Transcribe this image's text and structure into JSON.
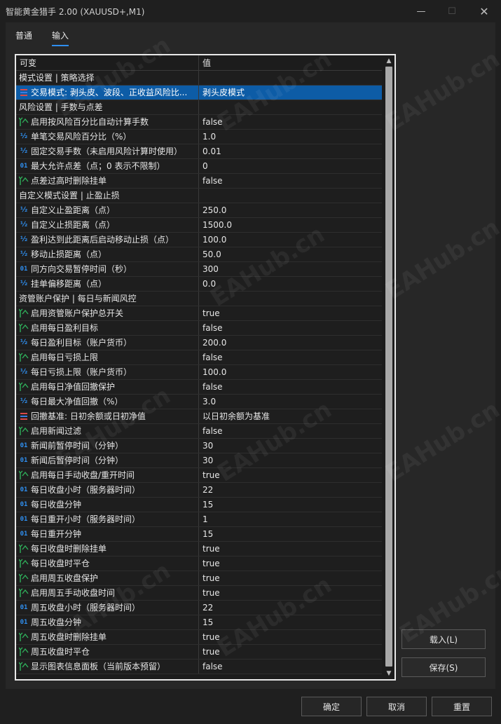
{
  "window": {
    "title": "智能黄金猎手 2.00 (XAUUSD+,M1)",
    "min_icon": "minimize-icon",
    "max_icon": "maximize-icon",
    "close_icon": "close-icon"
  },
  "tabs": [
    {
      "label": "普通",
      "active": false
    },
    {
      "label": "输入",
      "active": true
    }
  ],
  "grid": {
    "col_variable": "可变",
    "col_value": "值",
    "rows": [
      {
        "type": "group",
        "label": "模式设置 | 策略选择",
        "value": ""
      },
      {
        "type": "enum",
        "label": "交易模式: 剥头皮、波段、正收益风险比...",
        "value": "剥头皮模式",
        "selected": true
      },
      {
        "type": "group",
        "label": "风险设置 | 手数与点差",
        "value": ""
      },
      {
        "type": "bool",
        "label": "启用按风险百分比自动计算手数",
        "value": "false"
      },
      {
        "type": "double",
        "label": "单笔交易风险百分比（%）",
        "value": "1.0"
      },
      {
        "type": "double",
        "label": "固定交易手数（未启用风险计算时使用）",
        "value": "0.01"
      },
      {
        "type": "int",
        "label": "最大允许点差（点；0 表示不限制）",
        "value": "0"
      },
      {
        "type": "bool",
        "label": "点差过高时删除挂单",
        "value": "false"
      },
      {
        "type": "group",
        "label": "自定义模式设置 | 止盈止损",
        "value": ""
      },
      {
        "type": "double",
        "label": "自定义止盈距离（点）",
        "value": "250.0"
      },
      {
        "type": "double",
        "label": "自定义止损距离（点）",
        "value": "1500.0"
      },
      {
        "type": "double",
        "label": "盈利达到此距离后启动移动止损（点）",
        "value": "100.0"
      },
      {
        "type": "double",
        "label": "移动止损距离（点）",
        "value": "50.0"
      },
      {
        "type": "int",
        "label": "同方向交易暂停时间（秒）",
        "value": "300"
      },
      {
        "type": "double",
        "label": "挂单偏移距离（点）",
        "value": "0.0"
      },
      {
        "type": "group",
        "label": "资管账户保护 | 每日与新闻风控",
        "value": ""
      },
      {
        "type": "bool",
        "label": "启用资管账户保护总开关",
        "value": "true"
      },
      {
        "type": "bool",
        "label": "启用每日盈利目标",
        "value": "false"
      },
      {
        "type": "double",
        "label": "每日盈利目标（账户货币）",
        "value": "200.0"
      },
      {
        "type": "bool",
        "label": "启用每日亏损上限",
        "value": "false"
      },
      {
        "type": "double",
        "label": "每日亏损上限（账户货币）",
        "value": "100.0"
      },
      {
        "type": "bool",
        "label": "启用每日净值回撤保护",
        "value": "false"
      },
      {
        "type": "double",
        "label": "每日最大净值回撤（%）",
        "value": "3.0"
      },
      {
        "type": "enum",
        "label": "回撤基准: 日初余额或日初净值",
        "value": "以日初余额为基准"
      },
      {
        "type": "bool",
        "label": "启用新闻过滤",
        "value": "false"
      },
      {
        "type": "int",
        "label": "新闻前暂停时间（分钟）",
        "value": "30"
      },
      {
        "type": "int",
        "label": "新闻后暂停时间（分钟）",
        "value": "30"
      },
      {
        "type": "bool",
        "label": "启用每日手动收盘/重开时间",
        "value": "true"
      },
      {
        "type": "int",
        "label": "每日收盘小时（服务器时间）",
        "value": "22"
      },
      {
        "type": "int",
        "label": "每日收盘分钟",
        "value": "15"
      },
      {
        "type": "int",
        "label": "每日重开小时（服务器时间）",
        "value": "1"
      },
      {
        "type": "int",
        "label": "每日重开分钟",
        "value": "15"
      },
      {
        "type": "bool",
        "label": "每日收盘时删除挂单",
        "value": "true"
      },
      {
        "type": "bool",
        "label": "每日收盘时平仓",
        "value": "true"
      },
      {
        "type": "bool",
        "label": "启用周五收盘保护",
        "value": "true"
      },
      {
        "type": "bool",
        "label": "启用周五手动收盘时间",
        "value": "true"
      },
      {
        "type": "int",
        "label": "周五收盘小时（服务器时间）",
        "value": "22"
      },
      {
        "type": "int",
        "label": "周五收盘分钟",
        "value": "15"
      },
      {
        "type": "bool",
        "label": "周五收盘时删除挂单",
        "value": "true"
      },
      {
        "type": "bool",
        "label": "周五收盘时平仓",
        "value": "true"
      },
      {
        "type": "bool",
        "label": "显示图表信息面板（当前版本预留）",
        "value": "false"
      }
    ]
  },
  "side_buttons": {
    "load": "载入(L)",
    "save": "保存(S)"
  },
  "footer": {
    "ok": "确定",
    "cancel": "取消",
    "reset": "重置"
  },
  "watermark": "EAHub.cn",
  "colors": {
    "accent": "#2f8ff0",
    "selection": "#0d5ca6",
    "bool_icon": "#2fae5a",
    "enum_icon": "#d84a4a"
  }
}
